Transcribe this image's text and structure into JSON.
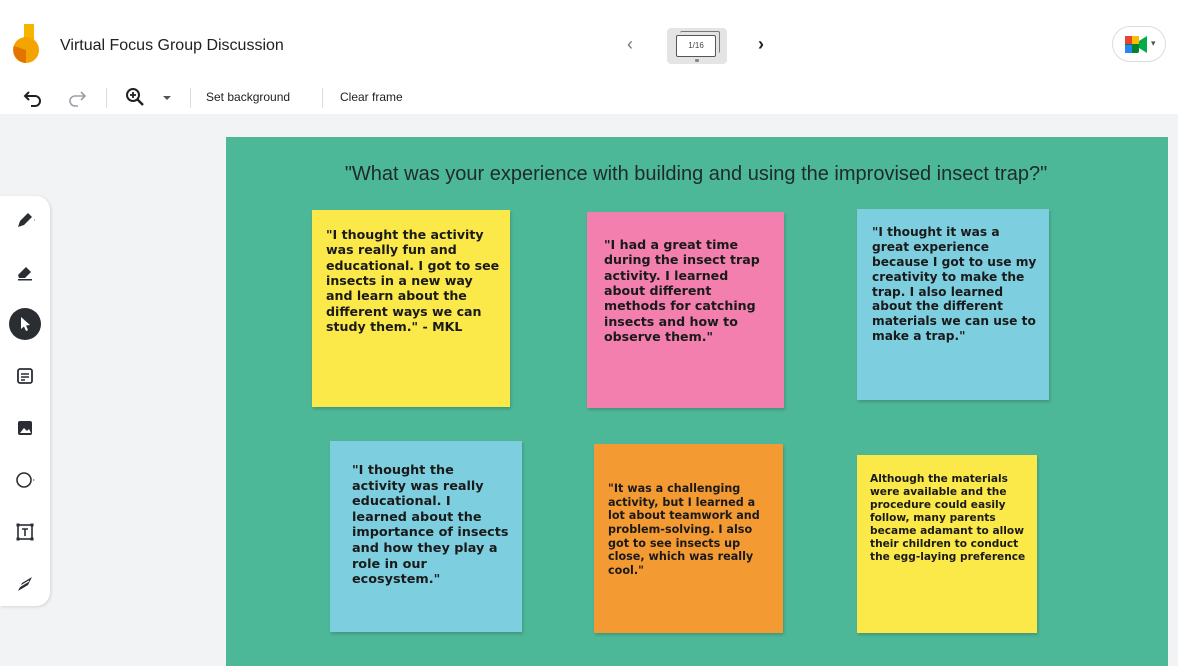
{
  "header": {
    "title": "Virtual Focus Group Discussion",
    "frame_indicator": "1/16",
    "prev_icon": "chevron-left-icon",
    "next_icon": "chevron-right-icon",
    "meet_icon": "google-meet-icon"
  },
  "toolbar": {
    "set_background": "Set background",
    "clear_frame": "Clear frame"
  },
  "rail": [
    "pen-icon",
    "eraser-icon",
    "select-cursor-icon",
    "sticky-note-icon",
    "image-icon",
    "circle-shape-icon",
    "text-box-icon",
    "laser-icon"
  ],
  "frame": {
    "background": "#4db897",
    "question": "\"What was your experience with building and using the improvised insect trap?\"",
    "notes": [
      {
        "color": "#fbe94a",
        "text": "\"I thought the activity was really fun and educational. I got to see insects in a new way and learn about the different ways we can study them.\" - MKL"
      },
      {
        "color": "#f27fae",
        "text": "\"I had a great time during the insect trap activity. I learned about different methods for catching insects and how to observe them.\""
      },
      {
        "color": "#7dcfe0",
        "text": "\"I thought it was a great experience because I got to use my creativity to make the trap. I also learned about the different materials we can use to make a trap.\""
      },
      {
        "color": "#7dcfe0",
        "text": "\"I thought the activity was really educational. I learned about the importance of insects and how they play a role in our ecosystem.\""
      },
      {
        "color": "#f49a33",
        "text": "\"It was a challenging activity, but I learned a lot about teamwork and problem-solving. I also got to see insects up close, which was really cool.\""
      },
      {
        "color": "#fbe94a",
        "text": "Although the materials were available and the procedure could easily follow, many parents became adamant to allow their children to conduct the egg-laying preference"
      }
    ]
  }
}
